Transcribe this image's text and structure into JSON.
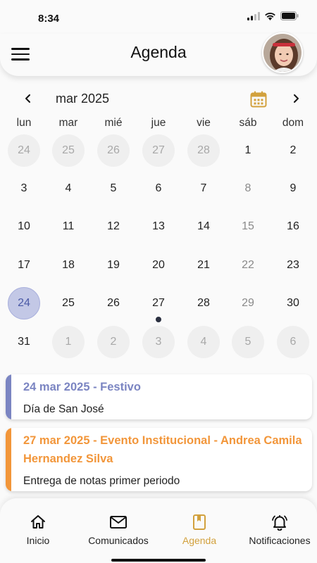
{
  "status_bar": {
    "time": "8:34",
    "icons": [
      "signal-icon",
      "wifi-icon",
      "battery-icon"
    ]
  },
  "appbar": {
    "title": "Agenda",
    "menu_icon": "menu-icon",
    "avatar": "user-avatar"
  },
  "calendar": {
    "month_label": "mar 2025",
    "weekdays": [
      "lun",
      "mar",
      "mié",
      "jue",
      "vie",
      "sáb",
      "dom"
    ],
    "weeks": [
      [
        {
          "d": "24",
          "t": "outside"
        },
        {
          "d": "25",
          "t": "outside"
        },
        {
          "d": "26",
          "t": "outside"
        },
        {
          "d": "27",
          "t": "outside"
        },
        {
          "d": "28",
          "t": "outside"
        },
        {
          "d": "1",
          "t": "normal"
        },
        {
          "d": "2",
          "t": "normal"
        }
      ],
      [
        {
          "d": "3",
          "t": "normal"
        },
        {
          "d": "4",
          "t": "normal"
        },
        {
          "d": "5",
          "t": "normal"
        },
        {
          "d": "6",
          "t": "normal"
        },
        {
          "d": "7",
          "t": "normal"
        },
        {
          "d": "8",
          "t": "weekend"
        },
        {
          "d": "9",
          "t": "normal"
        }
      ],
      [
        {
          "d": "10",
          "t": "normal"
        },
        {
          "d": "11",
          "t": "normal"
        },
        {
          "d": "12",
          "t": "normal"
        },
        {
          "d": "13",
          "t": "normal"
        },
        {
          "d": "14",
          "t": "normal"
        },
        {
          "d": "15",
          "t": "weekend"
        },
        {
          "d": "16",
          "t": "normal"
        }
      ],
      [
        {
          "d": "17",
          "t": "normal"
        },
        {
          "d": "18",
          "t": "normal"
        },
        {
          "d": "19",
          "t": "normal"
        },
        {
          "d": "20",
          "t": "normal"
        },
        {
          "d": "21",
          "t": "normal"
        },
        {
          "d": "22",
          "t": "weekend"
        },
        {
          "d": "23",
          "t": "normal"
        }
      ],
      [
        {
          "d": "24",
          "t": "selected"
        },
        {
          "d": "25",
          "t": "normal"
        },
        {
          "d": "26",
          "t": "normal"
        },
        {
          "d": "27",
          "t": "normal",
          "event": true
        },
        {
          "d": "28",
          "t": "normal"
        },
        {
          "d": "29",
          "t": "weekend"
        },
        {
          "d": "30",
          "t": "normal"
        }
      ],
      [
        {
          "d": "31",
          "t": "normal"
        },
        {
          "d": "1",
          "t": "outside"
        },
        {
          "d": "2",
          "t": "outside"
        },
        {
          "d": "3",
          "t": "outside"
        },
        {
          "d": "4",
          "t": "outside"
        },
        {
          "d": "5",
          "t": "outside"
        },
        {
          "d": "6",
          "t": "outside"
        }
      ]
    ]
  },
  "events": [
    {
      "title": "24 mar 2025 - Festivo",
      "description": "Día de San José",
      "color": "#7b85c2"
    },
    {
      "title": "27 mar 2025 - Evento Institucional - Andrea Camila Hernandez Silva",
      "description": "Entrega de notas primer periodo",
      "color": "#f2963a"
    }
  ],
  "bottom_nav": [
    {
      "label": "Inicio",
      "icon": "home-icon",
      "active": false
    },
    {
      "label": "Comunicados",
      "icon": "mail-icon",
      "active": false
    },
    {
      "label": "Agenda",
      "icon": "agenda-icon",
      "active": true
    },
    {
      "label": "Notificaciones",
      "icon": "bell-icon",
      "active": false
    }
  ],
  "colors": {
    "accent": "#d2a13d",
    "selected_day": "#c3c8e6",
    "festivo": "#7b85c2",
    "evento": "#f2963a"
  }
}
